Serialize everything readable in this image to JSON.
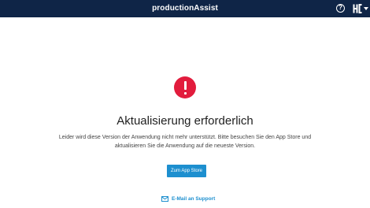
{
  "header": {
    "app_title": "productionAssist",
    "help_icon": "question-circle-icon",
    "help_glyph": "?",
    "logo_icon": "company-logo-icon",
    "menu_icon": "chevron-down-icon",
    "background_color": "#0f2547"
  },
  "main": {
    "status_icon": "exclamation-circle-icon",
    "status_color": "#e21c3d",
    "title": "Aktualisierung erforderlich",
    "message": "Leider wird diese Version der Anwendung nicht mehr unterstützt. Bitte besuchen Sie den App Store und aktualisieren Sie die Anwendung auf die neueste Version.",
    "app_store_button_label": "Zum App Store",
    "support_icon": "mail-icon",
    "support_link_label": "E-Mail an Support",
    "accent_color": "#1d8fcf"
  }
}
